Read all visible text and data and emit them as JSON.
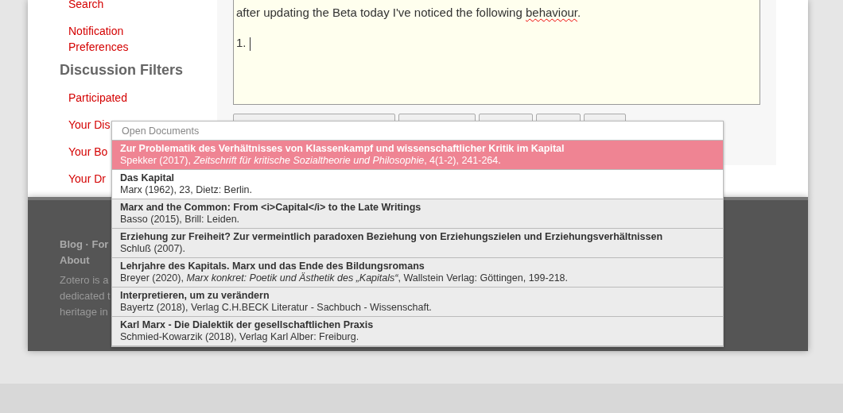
{
  "sidebar": {
    "items": [
      {
        "kind": "link",
        "label": "Search"
      },
      {
        "kind": "link",
        "label": "Notification Preferences"
      },
      {
        "kind": "heading",
        "label": "Discussion Filters"
      },
      {
        "kind": "link",
        "label": "Participated"
      },
      {
        "kind": "link",
        "label": "Your Dis"
      },
      {
        "kind": "link",
        "label": "Your Bo"
      },
      {
        "kind": "link",
        "label": "Your Dr"
      }
    ]
  },
  "editor": {
    "lines": [
      {
        "blank_line_before": false,
        "segments": [
          {
            "text": "after updating the Beta today I've noticed the following ",
            "spelling_error": false
          },
          {
            "text": "behaviour",
            "spelling_error": true
          },
          {
            "text": "."
          }
        ]
      },
      {
        "blank_line_before": true,
        "segments": [
          {
            "text": "1. ",
            "spelling_error": false
          }
        ]
      }
    ]
  },
  "footer": {
    "links": [
      "Blog · For",
      "About"
    ],
    "description": [
      "Zotero is a",
      "dedicated t",
      "heritage in"
    ]
  },
  "popup": {
    "header": "Open Documents",
    "items": [
      {
        "title": "Zur Problematik des Verhältnisses von Klassenkampf und wissenschaftlicher Kritik im Kapital",
        "citation": "Spekker (2017), *Zeitschrift für kritische Sozialtheorie und Philosophie*, 4(1-2), 241-264.",
        "selected": true
      },
      {
        "title": "Das Kapital",
        "citation": "Marx (1962), 23, Dietz: Berlin.",
        "selected": false
      },
      {
        "title": "Marx and the Common: From <i>Capital</i> to the Late Writings",
        "citation": "Basso (2015), Brill: Leiden.",
        "selected": false
      },
      {
        "title": "Erziehung zur Freiheit? Zur vermeintlich paradoxen Beziehung von Erziehungszielen und Erziehungsverhältnissen",
        "citation": "Schluß (2007).",
        "selected": false
      },
      {
        "title": "Lehrjahre des Kapitals. Marx und das Ende des Bildungsromans",
        "citation": "Breyer (2020), *Marx konkret: Poetik und Ästhetik des „Kapitals“*, Wallstein Verlag: Göttingen, 199-218.",
        "selected": false
      },
      {
        "title": "Interpretieren, um zu verändern",
        "citation": "Bayertz (2018), Verlag C.H.BECK Literatur - Sachbuch - Wissenschaft.",
        "selected": false
      },
      {
        "title": "Karl Marx - Die Dialektik der gesellschaftlichen Praxis",
        "citation": "Schmied-Kowarzik (2018), Verlag Karl Alber: Freiburg.",
        "selected": false
      }
    ]
  }
}
